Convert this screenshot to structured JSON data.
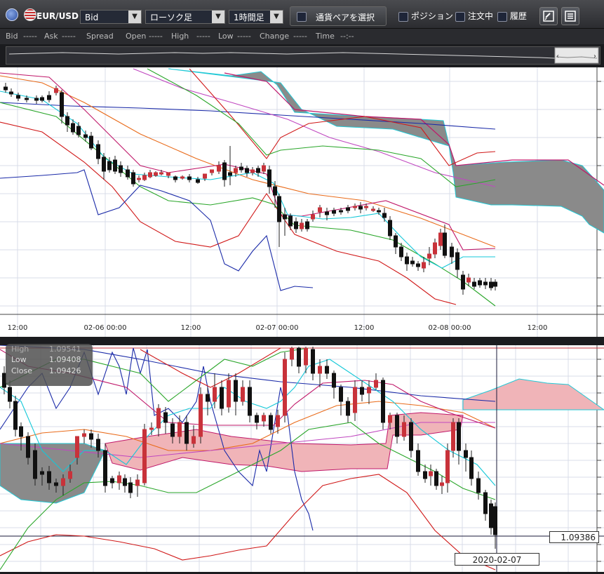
{
  "toolbar": {
    "pair": "EUR/USD",
    "price_type": "Bid",
    "chart_type": "ローソク足",
    "timeframe": "1時間足",
    "select_pair_label": "通貨ペアを選択",
    "position_label": "ポジション",
    "orders_label": "注文中",
    "history_label": "履歴"
  },
  "infobar": {
    "bid_label": "Bid",
    "bid_value": "-----",
    "ask_label": "Ask",
    "ask_value": "-----",
    "spread_label": "Spread",
    "open_label": "Open",
    "open_value": "-----",
    "high_label": "High",
    "high_value": "-----",
    "low_label": "Low",
    "low_value": "-----",
    "change_label": "Change",
    "change_value": "-----",
    "time_label": "Time",
    "time_value": "--:--"
  },
  "top_chart": {
    "x_labels": [
      "12:00",
      "02-06 00:00",
      "12:00",
      "02-07 00:00",
      "12:00",
      "02-08 00:00",
      "12:00"
    ]
  },
  "ohlc_panel": {
    "high_label": "High",
    "high_value": "1.09541",
    "low_label": "Low",
    "low_value": "1.09408",
    "close_label": "Close",
    "close_value": "1.09426"
  },
  "cursor": {
    "price": "1.09386",
    "date": "2020-02-07"
  },
  "colors": {
    "candle_up": "#c8323a",
    "candle_down": "#111111",
    "cloud_bear": "#8a8a8a",
    "cloud_bull": "#f0b4b8"
  },
  "chart_data": [
    {
      "type": "candlestick",
      "title": "",
      "instrument": "EUR/USD",
      "timeframe": "1時間足",
      "x_tick_labels": [
        "12:00",
        "02-06 00:00",
        "12:00",
        "02-07 00:00",
        "12:00",
        "02-08 00:00",
        "12:00"
      ],
      "overlays": [
        "Ichimoku cloud",
        "Bollinger bands",
        "moving averages"
      ]
    },
    {
      "type": "candlestick",
      "instrument": "EUR/USD",
      "hover": {
        "high": 1.09541,
        "low": 1.09408,
        "close": 1.09426
      },
      "crosshair_price": 1.09386,
      "crosshair_date": "2020-02-07",
      "overlays": [
        "Ichimoku cloud",
        "Bollinger bands",
        "moving averages"
      ]
    }
  ]
}
